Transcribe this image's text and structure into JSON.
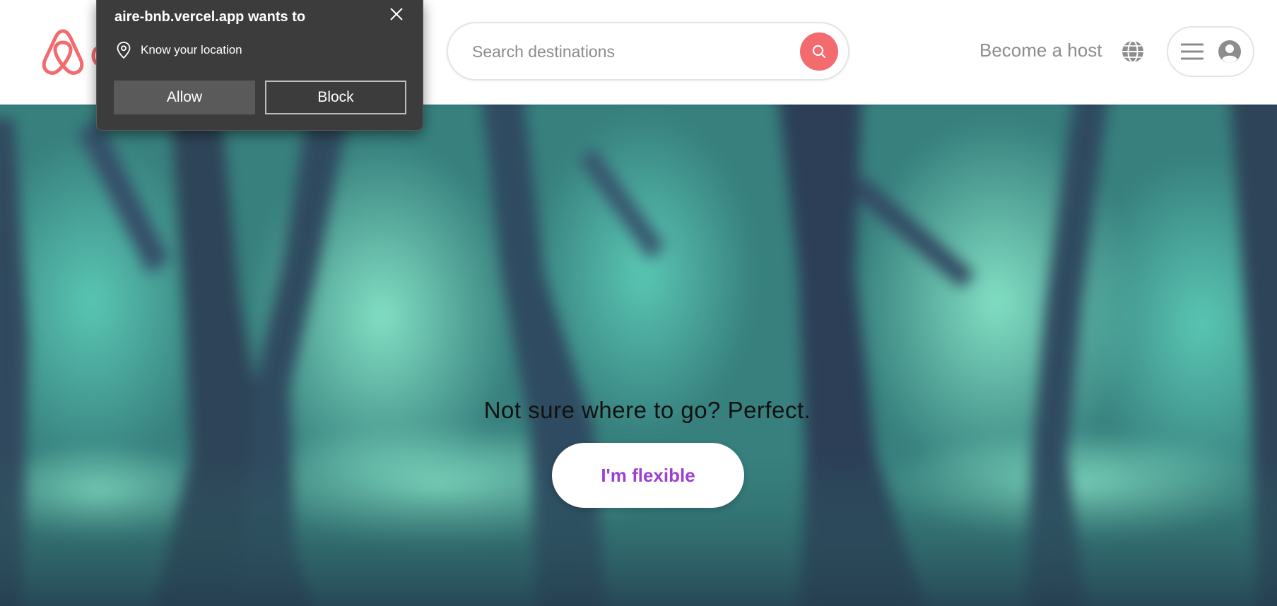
{
  "permission_prompt": {
    "title": "aire-bnb.vercel.app wants to",
    "request": "Know your location",
    "allow_label": "Allow",
    "block_label": "Block",
    "location_icon": "location-pin-icon",
    "close_icon": "close-icon"
  },
  "header": {
    "logo_icon": "airbnb-logo-icon",
    "brand_color": "#f36a6f",
    "search": {
      "placeholder": "Search destinations",
      "button_icon": "search-icon"
    },
    "become_host_label": "Become a host",
    "globe_icon": "globe-icon",
    "user_menu": {
      "menu_icon": "hamburger-menu-icon",
      "avatar_icon": "user-avatar-icon"
    }
  },
  "hero": {
    "tagline": "Not sure where to go? Perfect.",
    "cta_label": "I'm flexible",
    "cta_color": "#9b3fd6"
  }
}
